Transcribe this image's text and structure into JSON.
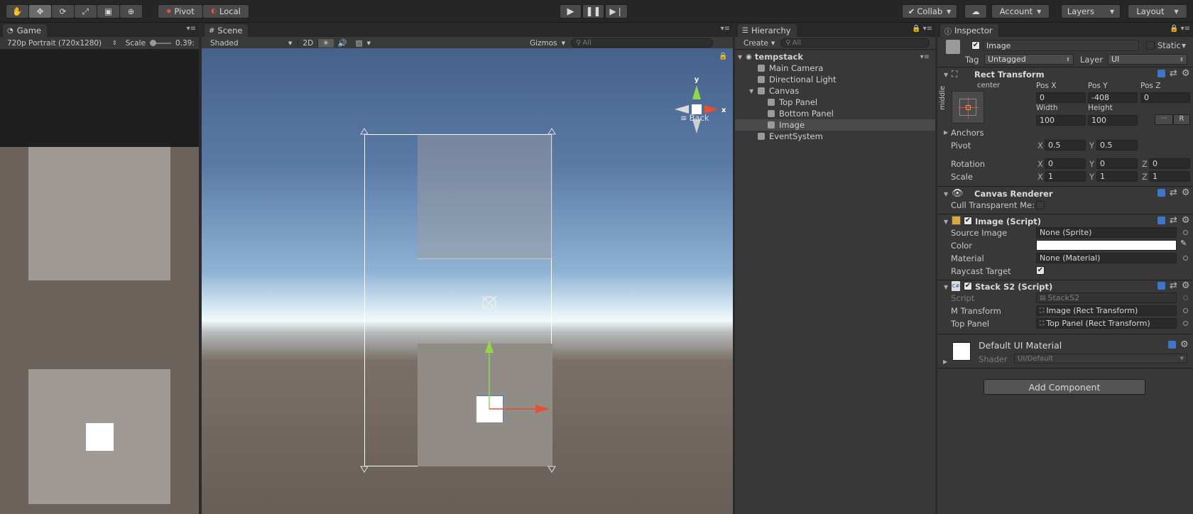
{
  "toolbar": {
    "pivot": "Pivot",
    "local": "Local",
    "collab": "Collab",
    "account": "Account",
    "layers": "Layers",
    "layout": "Layout"
  },
  "game": {
    "tab": "Game",
    "resolution": "720p Portrait (720x1280)",
    "scale_label": "Scale",
    "scale_value": "0.39:"
  },
  "scene": {
    "tab": "Scene",
    "shading": "Shaded",
    "mode_2d": "2D",
    "gizmos": "Gizmos",
    "search_placeholder": "All",
    "back_label": "Back",
    "axis_y": "y",
    "axis_x": "x"
  },
  "hierarchy": {
    "tab": "Hierarchy",
    "create": "Create",
    "search_placeholder": "All",
    "scene_name": "tempstack",
    "items": [
      {
        "label": "Main Camera",
        "depth": 1
      },
      {
        "label": "Directional Light",
        "depth": 1
      },
      {
        "label": "Canvas",
        "depth": 1
      },
      {
        "label": "Top Panel",
        "depth": 2
      },
      {
        "label": "Bottom Panel",
        "depth": 2
      },
      {
        "label": "Image",
        "depth": 2,
        "selected": true
      },
      {
        "label": "EventSystem",
        "depth": 1
      }
    ]
  },
  "inspector": {
    "tab": "Inspector",
    "object_name": "Image",
    "static_label": "Static",
    "tag_label": "Tag",
    "tag_value": "Untagged",
    "layer_label": "Layer",
    "layer_value": "UI",
    "rect_transform": {
      "title": "Rect Transform",
      "anchor_h": "center",
      "anchor_v": "middle",
      "posx_label": "Pos X",
      "posy_label": "Pos Y",
      "posz_label": "Pos Z",
      "posx": "0",
      "posy": "-408",
      "posz": "0",
      "width_label": "Width",
      "height_label": "Height",
      "width": "100",
      "height": "100",
      "r_button": "R",
      "anchors_label": "Anchors",
      "pivot_label": "Pivot",
      "pivot_x": "0.5",
      "pivot_y": "0.5",
      "rotation_label": "Rotation",
      "rot_x": "0",
      "rot_y": "0",
      "rot_z": "0",
      "scale_label": "Scale",
      "scale_x": "1",
      "scale_y": "1",
      "scale_z": "1",
      "x": "X",
      "y": "Y",
      "z": "Z"
    },
    "canvas_renderer": {
      "title": "Canvas Renderer",
      "cull_label": "Cull Transparent Me:"
    },
    "image_script": {
      "title": "Image (Script)",
      "source_label": "Source Image",
      "source_value": "None (Sprite)",
      "color_label": "Color",
      "color_value": "#ffffff",
      "material_label": "Material",
      "material_value": "None (Material)",
      "raycast_label": "Raycast Target"
    },
    "stack_script": {
      "title": "Stack S2 (Script)",
      "script_label": "Script",
      "script_value": "StackS2",
      "mtransform_label": "M Transform",
      "mtransform_value": "Image (Rect Transform)",
      "toppanel_label": "Top Panel",
      "toppanel_value": "Top Panel (Rect Transform)"
    },
    "material": {
      "title": "Default UI Material",
      "shader_label": "Shader",
      "shader_value": "UI/Default"
    },
    "add_component": "Add Component"
  },
  "colors": {
    "selection": "#4a4a4a",
    "accent_blue": "#3e77c9",
    "game_bg": "#6b625c",
    "panel_gray": "#a09a95"
  }
}
